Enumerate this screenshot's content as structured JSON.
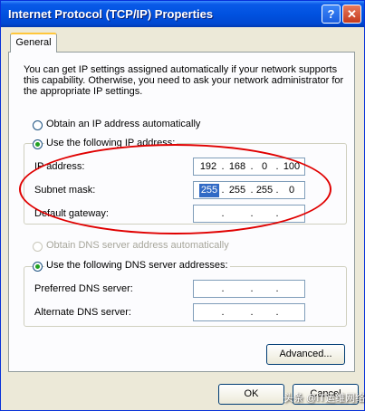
{
  "window": {
    "title": "Internet Protocol (TCP/IP) Properties",
    "help_glyph": "?",
    "close_glyph": "✕"
  },
  "tab": {
    "label": "General"
  },
  "intro": [
    "You can get IP settings assigned automatically if your network supports",
    "this capability. Otherwise, you need to ask your network administrator for",
    "the appropriate IP settings."
  ],
  "ip_options": {
    "auto": "Obtain an IP address automatically",
    "manual": "Use the following IP address:"
  },
  "fields": {
    "ip_address": {
      "label": "IP address:",
      "octets": [
        "192",
        "168",
        "0",
        "100"
      ]
    },
    "subnet_mask": {
      "label": "Subnet mask:",
      "octets": [
        "255",
        "255",
        "255",
        "0"
      ]
    },
    "default_gateway": {
      "label": "Default gateway:",
      "octets": [
        "",
        "",
        "",
        ""
      ]
    }
  },
  "dns_options": {
    "auto": "Obtain DNS server address automatically",
    "manual": "Use the following DNS server addresses:"
  },
  "dns_fields": {
    "preferred": {
      "label": "Preferred DNS server:",
      "octets": [
        "",
        "",
        "",
        ""
      ]
    },
    "alternate": {
      "label": "Alternate DNS server:",
      "octets": [
        "",
        "",
        "",
        ""
      ]
    }
  },
  "buttons": {
    "advanced": "Advanced...",
    "ok": "OK",
    "cancel": "Cancel"
  },
  "watermark": "头条 @IT运维网络",
  "colors": {
    "annotation_oval": "#e00000",
    "title_bar": "#0052e0"
  }
}
